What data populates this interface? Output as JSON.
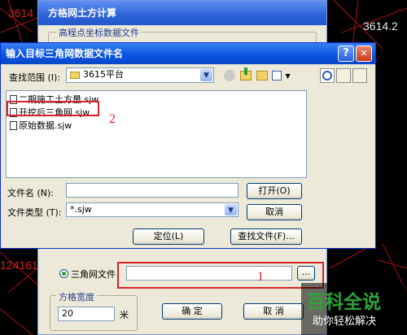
{
  "background": {
    "labels": [
      "3614",
      "3614.2",
      "124161"
    ]
  },
  "back_dialog": {
    "title": "方格网土方计算",
    "group_label": "高程点坐标数据文件",
    "radio_label": "三角网文件",
    "browse_label": "...",
    "grid_width_label": "方格宽度",
    "grid_width_value": "20",
    "unit": "米",
    "ok_label": "确    定",
    "cancel_label": "取    消"
  },
  "dialog": {
    "title": "输入目标三角网数据文件名",
    "help_label": "?",
    "close_label": "✕",
    "look_in_label": "查找范围 (I):",
    "look_in_value": "3615平台",
    "files": [
      "二期施工土方量.sjw",
      "开挖后三角网.sjw",
      "原始数据.sjw"
    ],
    "filename_label": "文件名 (N):",
    "filename_value": "",
    "filetype_label": "文件类型 (T):",
    "filetype_value": "*.sjw",
    "open_label": "打开(O)",
    "cancel_label": "取消",
    "locate_label": "定位(L)",
    "find_file_label": "查找文件(F)..."
  },
  "annotations": {
    "marker_1": "1",
    "marker_2": "2"
  },
  "watermark": {
    "name": "百科全说",
    "slogan": "助你轻松解决"
  },
  "colors": {
    "annotation_red": "#d6222a",
    "watermark_green": "#2ea23b",
    "titlebar_blue": "#0a55e0"
  }
}
